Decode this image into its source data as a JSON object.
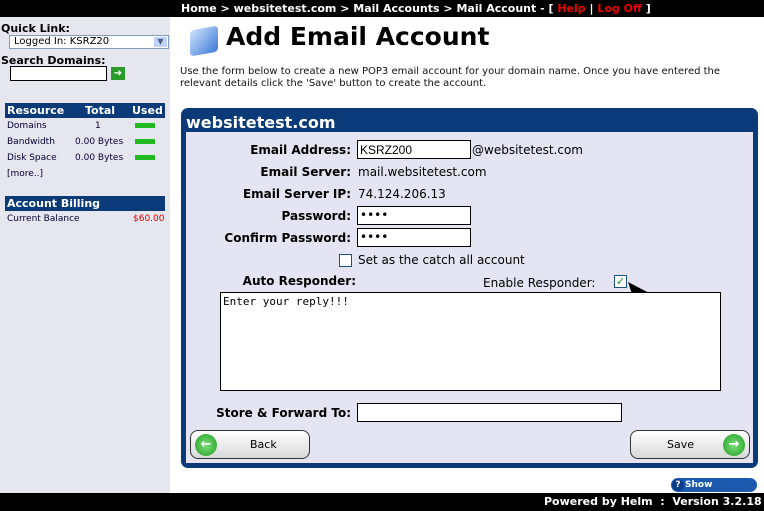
{
  "topbar": {
    "crumbs": [
      "Home",
      "websitetest.com",
      "Mail Accounts",
      "Mail Account"
    ],
    "sep": " > ",
    "dash": " - [ ",
    "help": "Help",
    "pipe": " | ",
    "logoff": "Log Off",
    "close": " ]"
  },
  "sidebar": {
    "quick_link_label": "Quick Link:",
    "quick_link_value": "Logged In: KSRZ20",
    "search_label": "Search Domains:",
    "search_value": "",
    "resource": {
      "headers": [
        "Resource",
        "Total",
        "Used"
      ],
      "rows": [
        {
          "name": "Domains",
          "total": "1",
          "used_pct": 100
        },
        {
          "name": "Bandwidth",
          "total": "0.00 Bytes",
          "used_pct": 100
        },
        {
          "name": "Disk Space",
          "total": "0.00 Bytes",
          "used_pct": 100
        }
      ],
      "more": "[more..]"
    },
    "billing": {
      "header": "Account Billing",
      "label": "Current Balance",
      "value": "$60.00"
    }
  },
  "page": {
    "title": "Add Email Account",
    "description": "Use the form below to create a new POP3 email account for your domain name. Once you have entered the relevant details click the 'Save' button to create the account."
  },
  "form": {
    "domain": "websitetest.com",
    "email_label": "Email Address:",
    "email_value": "KSRZ200",
    "email_suffix": "@websitetest.com",
    "server_label": "Email Server:",
    "server_value": "mail.websitetest.com",
    "ip_label": "Email Server IP:",
    "ip_value": "74.124.206.13",
    "password_label": "Password:",
    "password_value": "••••",
    "confirm_label": "Confirm Password:",
    "confirm_value": "••••",
    "catchall_label": "Set as the catch all account",
    "catchall_checked": false,
    "autoresponder_label": "Auto Responder:",
    "enable_label": "Enable Responder:",
    "enable_checked": true,
    "reply_value": "Enter your reply!!!",
    "forward_label": "Store & Forward To:",
    "forward_value": "",
    "back": "Back",
    "save": "Save"
  },
  "quickhelp": "Show QuickHelp",
  "footer": "Powered by Helm  :  Version 3.2.18",
  "colors": {
    "navy": "#0a3a78",
    "link_red": "#e00000",
    "used_green": "#22bb22"
  }
}
